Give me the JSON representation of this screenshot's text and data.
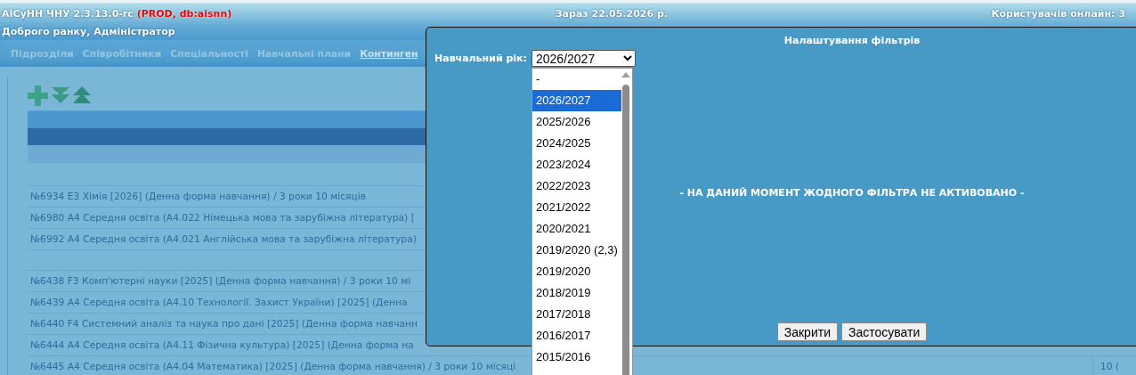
{
  "header": {
    "app_title": "АІСуНН ЧНУ 2.3.13.0-rc",
    "environment": "(PROD, db:aisnn)",
    "date": "Зараз 22.05.2026 р.",
    "online_users": "Користувачів онлайн: 3",
    "greeting": "Доброго ранку, Адміністратор"
  },
  "nav": [
    {
      "label": "Підрозділи",
      "selected": false
    },
    {
      "label": "Співробітники",
      "selected": false
    },
    {
      "label": "Спеціальності",
      "selected": false
    },
    {
      "label": "Навчальні плани",
      "selected": false
    },
    {
      "label": "Континген",
      "selected": true
    }
  ],
  "rows": [
    {
      "kind": "blank"
    },
    {
      "kind": "record",
      "text": "№6934 E3 Хімія [2026] (Денна форма навчання) / 3 роки 10 місяців"
    },
    {
      "kind": "record",
      "text": "№6980 A4 Середня освіта (A4.022 Німецька мова та зарубіжна література) ["
    },
    {
      "kind": "record",
      "text": "№6992 A4 Середня освіта (A4.021 Англійська мова та зарубіжна література)"
    },
    {
      "kind": "blank"
    },
    {
      "kind": "record",
      "text": "№6438 F3 Комп'ютерні науки [2025] (Денна форма навчання) / 3 роки 10 мі"
    },
    {
      "kind": "record",
      "text": "№6439 A4 Середня освіта (A4.10 Технології. Захист України) [2025] (Денна"
    },
    {
      "kind": "record",
      "text": "№6440 F4 Системний аналіз та наука про дані [2025] (Денна форма навчанн"
    },
    {
      "kind": "record",
      "text": "№6444 A4 Середня освіта (A4.11 Фізична культура) [2025] (Денна форма на"
    },
    {
      "kind": "record",
      "text": "№6445 A4 Середня освіта (A4.04 Математика) [2025] (Денна форма навчання) / 3 роки 10 місяці",
      "column_2": "10 ("
    }
  ],
  "dialog": {
    "title": "Налаштування фільтрів",
    "field_label": "Навчальний рік:",
    "select_value": "2026/2027",
    "options": [
      {
        "label": "-",
        "selected": false
      },
      {
        "label": "2026/2027",
        "selected": true
      },
      {
        "label": "2025/2026",
        "selected": false
      },
      {
        "label": "2024/2025",
        "selected": false
      },
      {
        "label": "2023/2024",
        "selected": false
      },
      {
        "label": "2022/2023",
        "selected": false
      },
      {
        "label": "2021/2022",
        "selected": false
      },
      {
        "label": "2020/2021",
        "selected": false
      },
      {
        "label": "2019/2020 (2,3)",
        "selected": false
      },
      {
        "label": "2019/2020",
        "selected": false
      },
      {
        "label": "2018/2019",
        "selected": false
      },
      {
        "label": "2017/2018",
        "selected": false
      },
      {
        "label": "2016/2017",
        "selected": false
      },
      {
        "label": "2015/2016",
        "selected": false
      }
    ],
    "message": "- НА ДАНИЙ МОМЕНТ ЖОДНОГО ФІЛЬТРА НЕ АКТИВОВАНО -",
    "buttons": [
      "Закрити",
      "Застосувати"
    ]
  }
}
